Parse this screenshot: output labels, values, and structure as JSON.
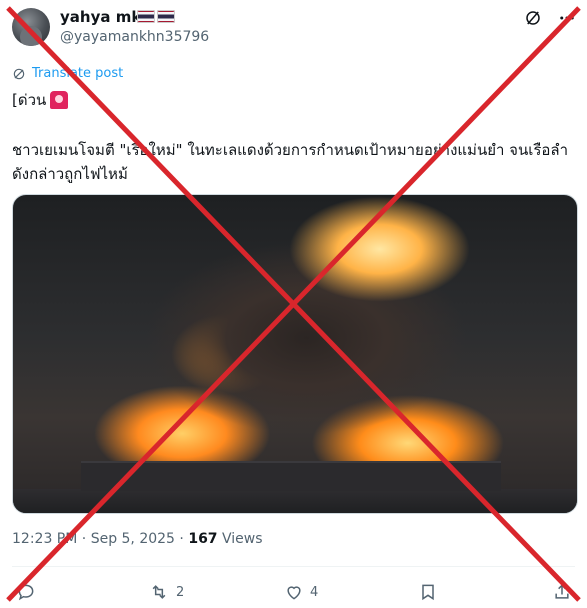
{
  "post": {
    "author": {
      "display_name": "yahya mk.",
      "handle": "@yayamankhn35796"
    },
    "translate_label": "Translate post",
    "tag": "[ด่วน",
    "text": "ชาวเยเมนโจมตี \"เรือใหม่\" ในทะเลแดงด้วยการกำหนดเป้าหมายอย่างแม่นยำ จนเรือลำดังกล่าวถูกไฟไหม้",
    "time": "12:23 PM",
    "date": "Sep 5, 2025",
    "views_count": "167",
    "views_label": "Views",
    "separator": "·"
  },
  "actions": {
    "reply_count": "",
    "retweet_count": "2",
    "like_count": "4"
  },
  "icons": [
    "grok-icon",
    "more-icon",
    "translate-icon",
    "siren-icon",
    "reply-icon",
    "retweet-icon",
    "like-icon",
    "bookmark-icon",
    "share-icon"
  ],
  "colors": {
    "overlay_cross": "#d9262c",
    "link": "#1d9bf0",
    "secondary_text": "#536471"
  }
}
